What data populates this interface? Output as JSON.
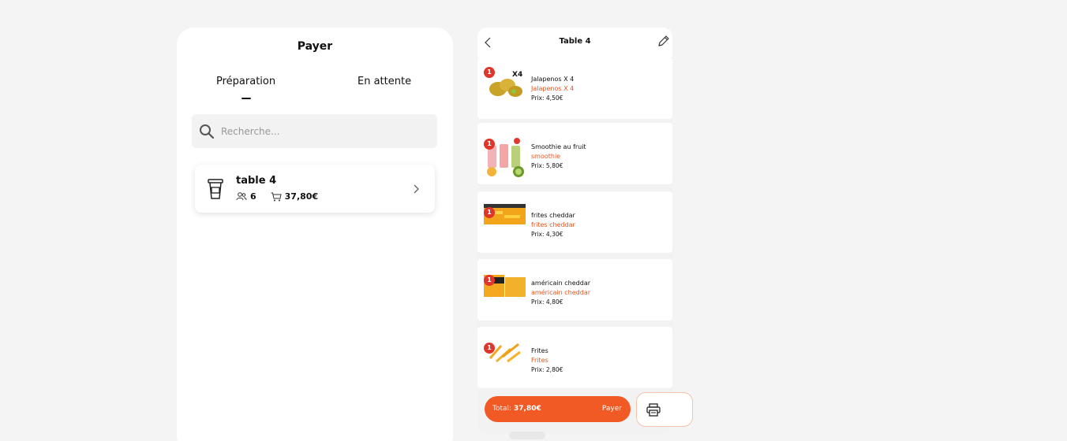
{
  "left": {
    "title": "Payer",
    "tabs": [
      {
        "label": "Préparation",
        "active": true
      },
      {
        "label": "En attente",
        "active": false
      }
    ],
    "search": {
      "placeholder": "Recherche...",
      "value": "",
      "icon": "search-icon"
    },
    "order": {
      "name": "table 4",
      "guests": "6",
      "total": "37,80€",
      "icons": [
        "cup-icon",
        "people-icon",
        "cart-icon",
        "chevron-right-icon"
      ]
    }
  },
  "right": {
    "title": "Table 4",
    "icons": [
      "chevron-left-icon",
      "pencil-icon"
    ],
    "items": [
      {
        "qty": "1",
        "name": "Jalapenos X 4",
        "sub": "Jalapenos X 4",
        "price": "Prix: 4,50€",
        "image_text": "X4"
      },
      {
        "qty": "1",
        "name": "Smoothie au fruit",
        "sub": "smoothie",
        "price": "Prix: 5,80€",
        "image_text": ""
      },
      {
        "qty": "1",
        "name": "frites cheddar",
        "sub": "frites cheddar",
        "price": "Prix: 4,30€",
        "image_text": ""
      },
      {
        "qty": "1",
        "name": "américain cheddar",
        "sub": "américain cheddar",
        "price": "Prix: 4,80€",
        "image_text": ""
      },
      {
        "qty": "1",
        "name": "Frites",
        "sub": "Frites",
        "price": "Prix: 2,80€",
        "image_text": ""
      }
    ],
    "footer": {
      "total_label": "Total:",
      "total_value": "37,80€",
      "pay_label": "Payer",
      "print_icon": "printer-icon"
    }
  },
  "colors": {
    "accent": "#f15a24",
    "badge": "#e0352b",
    "subtitle": "#e8541f",
    "background": "#f4f4f4"
  }
}
